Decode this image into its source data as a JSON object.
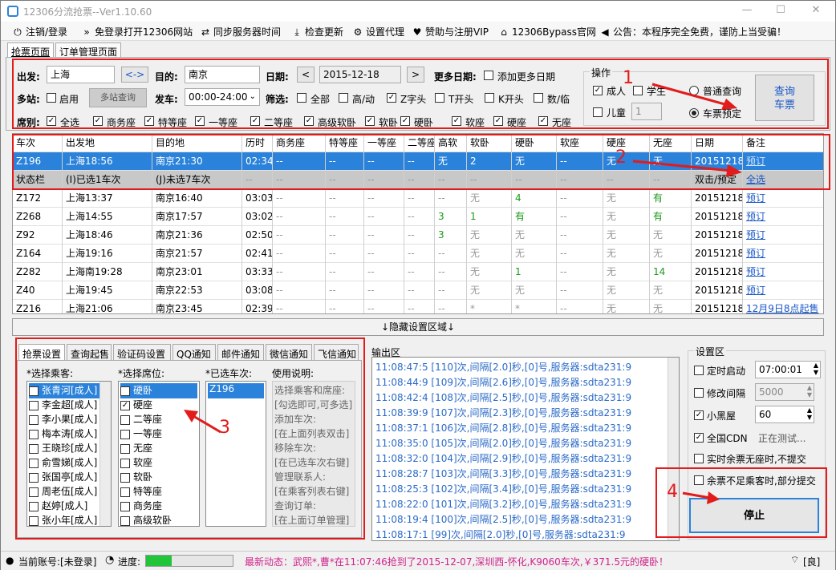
{
  "window": {
    "title": "12306分流抢票--Ver1.10.60"
  },
  "menu": {
    "login": "注销/登录",
    "open_site": "免登录打开12306网站",
    "sync_time": "同步服务器时间",
    "check_update": "检查更新",
    "proxy": "设置代理",
    "vip": "赞助与注册VIP",
    "bypass": "12306Bypass官网",
    "notice": "公告：本程序完全免费，谨防上当受骗！"
  },
  "page_tabs": [
    "抢票页面",
    "订单管理页面"
  ],
  "query": {
    "from_label": "出发:",
    "from_value": "上海",
    "swap": "<->",
    "to_label": "目的:",
    "to_value": "南京",
    "date_label": "日期:",
    "date_value": "2015-12-18",
    "prev": "<",
    "next": ">",
    "more_dates_label": "更多日期:",
    "add_dates": "添加更多日期",
    "multi_station_label": "多站:",
    "enable": "启用",
    "multi_query": "多站查询",
    "depart_label": "发车:",
    "depart_value": "00:00-24:00",
    "filter_label": "筛选:",
    "filters": [
      {
        "label": "全部",
        "checked": false
      },
      {
        "label": "高/动",
        "checked": false
      },
      {
        "label": "Z字头",
        "checked": true
      },
      {
        "label": "T开头",
        "checked": false
      },
      {
        "label": "K开头",
        "checked": false
      },
      {
        "label": "数/临",
        "checked": false
      }
    ],
    "seat_label": "席别:",
    "seats": [
      "全选",
      "商务座",
      "特等座",
      "一等座",
      "二等座",
      "高级软卧",
      "软卧",
      "硬卧",
      "软座",
      "硬座",
      "无座"
    ]
  },
  "ops": {
    "title": "操作",
    "adult": "成人",
    "student": "学生",
    "child": "儿童",
    "child_count": "1",
    "normal_query": "普通查询",
    "reserve": "车票预定",
    "query_btn_1": "查询",
    "query_btn_2": "车票"
  },
  "annotations": [
    "1",
    "2",
    "3",
    "4"
  ],
  "table": {
    "headers": [
      "车次",
      "出发地",
      "目的地",
      "历时",
      "商务座",
      "特等座",
      "一等座",
      "二等座",
      "高软",
      "软卧",
      "硬卧",
      "软座",
      "硬座",
      "无座",
      "日期",
      "备注"
    ],
    "selected_row": [
      "Z196",
      "上海18:56",
      "南京21:30",
      "02:34",
      "--",
      "--",
      "--",
      "--",
      "无",
      "2",
      "无",
      "--",
      "无",
      "无",
      "20151218",
      "预订"
    ],
    "status_row": [
      "状态栏",
      "(I)已选1车次",
      "(J)未选7车次",
      "--",
      "--",
      "--",
      "--",
      "--",
      "--",
      "--",
      "--",
      "--",
      "--",
      "--",
      "双击/预定",
      "全选"
    ],
    "rows": [
      [
        "Z172",
        "上海13:37",
        "南京16:40",
        "03:03",
        "--",
        "--",
        "--",
        "--",
        "--",
        "无",
        "4",
        "--",
        "无",
        "有",
        "20151218",
        "预订"
      ],
      [
        "Z268",
        "上海14:55",
        "南京17:57",
        "03:02",
        "--",
        "--",
        "--",
        "--",
        "3",
        "1",
        "有",
        "--",
        "无",
        "有",
        "20151218",
        "预订"
      ],
      [
        "Z92",
        "上海18:46",
        "南京21:36",
        "02:50",
        "--",
        "--",
        "--",
        "--",
        "3",
        "无",
        "无",
        "--",
        "无",
        "无",
        "20151218",
        "预订"
      ],
      [
        "Z164",
        "上海19:16",
        "南京21:57",
        "02:41",
        "--",
        "--",
        "--",
        "--",
        "--",
        "无",
        "无",
        "--",
        "无",
        "无",
        "20151218",
        "预订"
      ],
      [
        "Z282",
        "上海南19:28",
        "南京23:01",
        "03:33",
        "--",
        "--",
        "--",
        "--",
        "--",
        "无",
        "1",
        "--",
        "无",
        "14",
        "20151218",
        "预订"
      ],
      [
        "Z40",
        "上海19:45",
        "南京22:53",
        "03:08",
        "--",
        "--",
        "--",
        "--",
        "--",
        "无",
        "无",
        "--",
        "无",
        "无",
        "20151218",
        "预订"
      ],
      [
        "Z216",
        "上海21:06",
        "南京23:45",
        "02:39",
        "--",
        "--",
        "--",
        "--",
        "--",
        "*",
        "*",
        "--",
        "无",
        "无",
        "20151218",
        "12月9日8点起售"
      ]
    ]
  },
  "hide_bar": "↓隐藏设置区域↓",
  "left_tabs": [
    "抢票设置",
    "查询起售",
    "验证码设置",
    "QQ通知",
    "邮件通知",
    "微信通知",
    "飞信通知"
  ],
  "passengers": {
    "title": "*选择乘客:",
    "items": [
      {
        "name": "张青河[成人]",
        "checked": true
      },
      {
        "name": "李金超[成人]",
        "checked": false
      },
      {
        "name": "李小果[成人]",
        "checked": false
      },
      {
        "name": "梅本涛[成人]",
        "checked": false
      },
      {
        "name": "王晓珍[成人]",
        "checked": false
      },
      {
        "name": "俞雪娣[成人]",
        "checked": false
      },
      {
        "name": "张国亭[成人]",
        "checked": false
      },
      {
        "name": "周老伍[成人]",
        "checked": false
      },
      {
        "name": "赵婷[成人]",
        "checked": false
      },
      {
        "name": "张小年[成人]",
        "checked": false
      }
    ]
  },
  "seat_select": {
    "title": "*选择席位:",
    "items": [
      {
        "name": "硬卧",
        "checked": false
      },
      {
        "name": "硬座",
        "checked": true
      },
      {
        "name": "二等座",
        "checked": false
      },
      {
        "name": "一等座",
        "checked": false
      },
      {
        "name": "无座",
        "checked": false
      },
      {
        "name": "软座",
        "checked": false
      },
      {
        "name": "软卧",
        "checked": false
      },
      {
        "name": "特等座",
        "checked": false
      },
      {
        "name": "商务座",
        "checked": false
      },
      {
        "name": "高级软卧",
        "checked": false
      }
    ]
  },
  "selected_trains": {
    "title": "*已选车次:",
    "items": [
      "Z196"
    ]
  },
  "usage": {
    "title": "使用说明:",
    "lines": [
      "选择乘客和席座:",
      "[勾选即可,可多选]",
      "添加车次:",
      "[在上面列表双击]",
      "移除车次:",
      "[在已选车次右键]",
      "管理联系人:",
      "[在乘客列表右键]",
      "查询订单:",
      "[在上面订单管理]"
    ]
  },
  "output": {
    "title": "输出区",
    "lines": [
      "11:08:47:5 [110]次,间隔[2.0]秒,[0]号,服务器:sdta231:9",
      "11:08:44:9 [109]次,间隔[2.6]秒,[0]号,服务器:sdta231:9",
      "11:08:42:4 [108]次,间隔[2.5]秒,[0]号,服务器:sdta231:9",
      "11:08:39:9 [107]次,间隔[2.3]秒,[0]号,服务器:sdta231:9",
      "11:08:37:1 [106]次,间隔[2.8]秒,[0]号,服务器:sdta231:9",
      "11:08:35:0 [105]次,间隔[2.0]秒,[0]号,服务器:sdta231:9",
      "11:08:32:0 [104]次,间隔[2.9]秒,[0]号,服务器:sdta231:9",
      "11:08:28:7 [103]次,间隔[3.3]秒,[0]号,服务器:sdta231:9",
      "11:08:25:3 [102]次,间隔[3.4]秒,[0]号,服务器:sdta231:9",
      "11:08:22:0 [101]次,间隔[3.2]秒,[0]号,服务器:sdta231:9",
      "11:08:19:4 [100]次,间隔[2.5]秒,[0]号,服务器:sdta231:9",
      "11:08:17:1 [99]次,间隔[2.0]秒,[0]号,服务器:sdta231:9"
    ]
  },
  "settings": {
    "title": "设置区",
    "timer_label": "定时启动",
    "timer_value": "07:00:01",
    "interval_label": "修改间隔",
    "interval_value": "5000",
    "blackroom_label": "小黑屋",
    "blackroom_value": "60",
    "cdn_label": "全国CDN",
    "cdn_status": "正在测试...",
    "no_seat_label": "实时余票无座时,不提交",
    "partial_label": "余票不足乘客时,部分提交",
    "stop_btn": "停止"
  },
  "status": {
    "account": "当前账号:[未登录]",
    "progress_label": "进度:",
    "progress": 0.3,
    "news": "最新动态：武熙*,曹*在11:07:46抢到了2015-12-07,深圳西-怀化,K9060车次,￥371.5元的硬卧！",
    "right": "[良]"
  },
  "colors": {
    "accent": "#2a82da",
    "annotation": "#e21b1b",
    "link": "#1a58c8",
    "news": "#d0248a",
    "progress": "#22c43a"
  }
}
